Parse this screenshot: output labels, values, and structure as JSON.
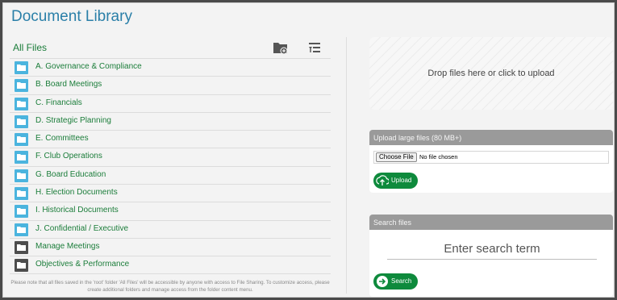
{
  "page": {
    "title": "Document Library"
  },
  "files": {
    "root_label": "All Files",
    "toolbar": {
      "new_folder_icon": "folder-add-icon",
      "sort_icon": "sort-icon"
    },
    "items": [
      {
        "label": "A. Governance & Compliance",
        "icon": "folder-icon",
        "color": "#4bb4de"
      },
      {
        "label": "B. Board Meetings",
        "icon": "folder-icon",
        "color": "#4bb4de"
      },
      {
        "label": "C. Financials",
        "icon": "folder-icon",
        "color": "#4bb4de"
      },
      {
        "label": "D. Strategic Planning",
        "icon": "folder-icon",
        "color": "#4bb4de"
      },
      {
        "label": "E. Committees",
        "icon": "folder-icon",
        "color": "#4bb4de"
      },
      {
        "label": "F. Club Operations",
        "icon": "folder-icon",
        "color": "#4bb4de"
      },
      {
        "label": "G. Board Education",
        "icon": "folder-icon",
        "color": "#4bb4de"
      },
      {
        "label": "H. Election Documents",
        "icon": "folder-icon",
        "color": "#4bb4de"
      },
      {
        "label": "I. Historical Documents",
        "icon": "folder-icon",
        "color": "#4bb4de"
      },
      {
        "label": "J. Confidential / Executive",
        "icon": "folder-icon",
        "color": "#4bb4de"
      },
      {
        "label": "Manage Meetings",
        "icon": "folder-icon",
        "color": "#4d4d4d"
      },
      {
        "label": "Objectives & Performance",
        "icon": "folder-icon",
        "color": "#4d4d4d"
      }
    ],
    "note": "Please note that all files saved in the 'root' folder 'All Files' will be accessible by anyone with access to File Sharing. To customize access, please create additional folders and manage access from the folder content menu."
  },
  "dropzone": {
    "label": "Drop files here or click to upload"
  },
  "upload": {
    "header": "Upload large files (80 MB+)",
    "choose_label": "Choose File",
    "file_status": "No file chosen",
    "button_label": "Upload"
  },
  "search": {
    "header": "Search files",
    "placeholder": "Enter search term",
    "button_label": "Search"
  },
  "colors": {
    "accent": "#2a7fa8",
    "link": "#1b7d3a",
    "button": "#0e8a3c",
    "panel_header": "#9a9a9a"
  }
}
